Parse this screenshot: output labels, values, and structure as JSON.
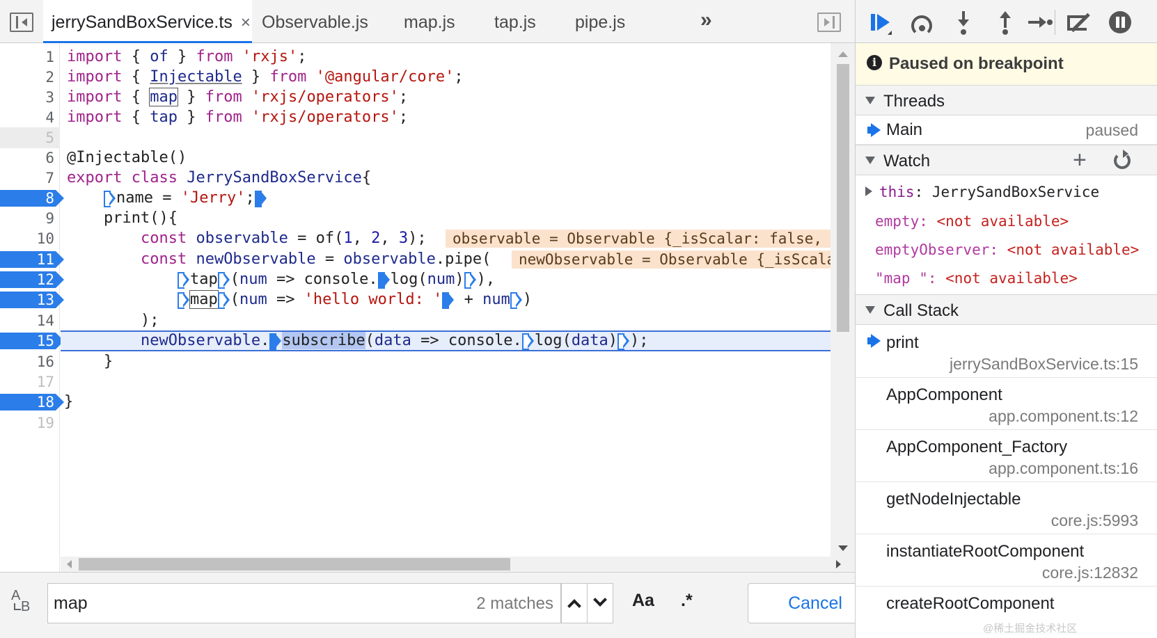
{
  "tabs": [
    {
      "label": "jerrySandBoxService.ts",
      "active": true,
      "closable": true
    },
    {
      "label": "Observable.js"
    },
    {
      "label": "map.js"
    },
    {
      "label": "tap.js"
    },
    {
      "label": "pipe.js"
    }
  ],
  "tabs_more_label": "»",
  "close_glyph": "×",
  "line_numbers": [
    "1",
    "2",
    "3",
    "4",
    "5",
    "6",
    "7",
    "8",
    "9",
    "10",
    "11",
    "12",
    "13",
    "14",
    "15",
    "16",
    "17",
    "18",
    "19"
  ],
  "code": {
    "l1": {
      "kw1": "import",
      "p1": " { ",
      "id": "of",
      "p2": " } ",
      "kw2": "from",
      "p3": " ",
      "str": "'rxjs'",
      "p4": ";"
    },
    "l2": {
      "kw1": "import",
      "p1": " { ",
      "id": "Injectable",
      "p2": " } ",
      "kw2": "from",
      "p3": " ",
      "str": "'@angular/core'",
      "p4": ";"
    },
    "l3": {
      "kw1": "import",
      "p1": " { ",
      "id": "map",
      "p2": " } ",
      "kw2": "from",
      "p3": " ",
      "str": "'rxjs/operators'",
      "p4": ";"
    },
    "l4": {
      "kw1": "import",
      "p1": " { ",
      "id": "tap",
      "p2": " } ",
      "kw2": "from",
      "p3": " ",
      "str": "'rxjs/operators'",
      "p4": ";"
    },
    "l6": {
      "text": "@Injectable()"
    },
    "l7": {
      "kw1": "export",
      "p1": " ",
      "kw2": "class",
      "p2": " ",
      "id": "JerrySandBoxService",
      "p3": "{"
    },
    "l8": {
      "indent": "    ",
      "name": "name",
      "p1": " = ",
      "str": "'Jerry'",
      "p2": ";"
    },
    "l9": {
      "indent": "    ",
      "text": "print(){"
    },
    "l10": {
      "indent": "        ",
      "kw": "const",
      "p1": " ",
      "id": "observable",
      "p2": " = of(",
      "n1": "1",
      "c1": ", ",
      "n2": "2",
      "c2": ", ",
      "n3": "3",
      "p3": ");",
      "inline": "observable = Observable {_isScalar: false, _subscribe: f}"
    },
    "l11": {
      "indent": "        ",
      "kw": "const",
      "p1": " ",
      "id": "newObservable",
      "p2": " = ",
      "id2": "observable",
      "p3": ".pipe(",
      "inline": "newObservable = Observable {_isScalar: false, source: Observable}"
    },
    "l12": {
      "indent": "            ",
      "fn": "tap",
      "p1": "(",
      "id": "num",
      "p2": " => console.",
      "fn2": "log",
      "p3": "(",
      "id2": "num",
      "p4": ")",
      "p5": "),"
    },
    "l13": {
      "indent": "            ",
      "fn": "map",
      "p1": "(",
      "id": "num",
      "p2": " => ",
      "str": "'hello world: '",
      "p3": " + ",
      "id2": "num",
      "p4": ")"
    },
    "l14": {
      "indent": "        ",
      "text": ");"
    },
    "l15": {
      "indent": "        ",
      "id": "newObservable",
      "p1": ".",
      "fn": "subscribe",
      "p2": "(",
      "id2": "data",
      "p3": " => console.",
      "fn2": "log",
      "p4": "(",
      "id3": "data",
      "p5": ")",
      "p6": ");"
    },
    "l16": {
      "indent": "    ",
      "text": "}"
    },
    "l18": {
      "text": "}"
    }
  },
  "search": {
    "value": "map",
    "match_count": "2 matches",
    "case_label": "Aa",
    "regex_label": ".*",
    "cancel_label": "Cancel"
  },
  "replace_toggle": {
    "a": "A",
    "b": "B"
  },
  "sidebar": {
    "paused_text": "Paused on breakpoint",
    "info_glyph": "i",
    "threads_title": "Threads",
    "thread": {
      "name": "Main",
      "status": "paused"
    },
    "watch_title": "Watch",
    "watch_add": "+",
    "watch": [
      {
        "name": "this",
        "sep": ": ",
        "value": "JerrySandBoxService",
        "available": true
      },
      {
        "name": "empty",
        "sep": ": ",
        "value": "<not available>",
        "available": false
      },
      {
        "name": "emptyObserver",
        "sep": ": ",
        "value": "<not available>",
        "available": false
      },
      {
        "name": "\"map \"",
        "sep": ": ",
        "value": "<not available>",
        "available": false
      }
    ],
    "callstack_title": "Call Stack",
    "frames": [
      {
        "fn": "print",
        "loc": "jerrySandBoxService.ts:15",
        "current": true
      },
      {
        "fn": "AppComponent",
        "loc": "app.component.ts:12"
      },
      {
        "fn": "AppComponent_Factory",
        "loc": "app.component.ts:16"
      },
      {
        "fn": "getNodeInjectable",
        "loc": "core.js:5993"
      },
      {
        "fn": "instantiateRootComponent",
        "loc": "core.js:12832"
      },
      {
        "fn": "createRootComponent",
        "loc": ""
      }
    ]
  },
  "watermark": "@稀土掘金技术社区",
  "colors": {
    "accent": "#1a73e8",
    "breakpoint": "#2b7de9",
    "paused_banner": "#fffbe5",
    "inline_value_bg": "#fbe2cc",
    "keyword": "#a0238b",
    "string": "#b5160f"
  }
}
